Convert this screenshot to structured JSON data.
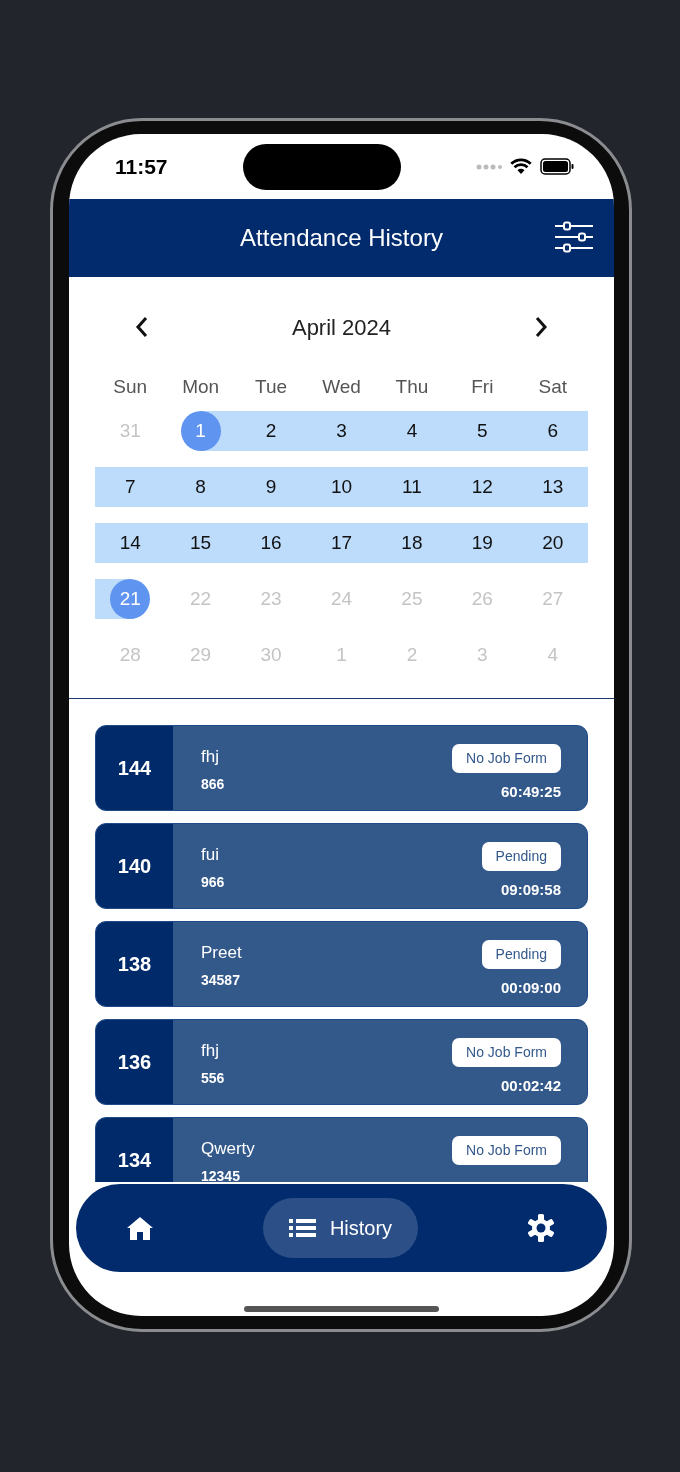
{
  "status_bar": {
    "time": "11:57"
  },
  "header": {
    "title": "Attendance History"
  },
  "calendar": {
    "month": "April 2024",
    "weekdays": [
      "Sun",
      "Mon",
      "Tue",
      "Wed",
      "Thu",
      "Fri",
      "Sat"
    ],
    "weeks": [
      [
        {
          "day": "31",
          "muted": true,
          "selected": false,
          "in_range": false
        },
        {
          "day": "1",
          "muted": false,
          "selected": true,
          "in_range": true
        },
        {
          "day": "2",
          "muted": false,
          "selected": false,
          "in_range": true
        },
        {
          "day": "3",
          "muted": false,
          "selected": false,
          "in_range": true
        },
        {
          "day": "4",
          "muted": false,
          "selected": false,
          "in_range": true
        },
        {
          "day": "5",
          "muted": false,
          "selected": false,
          "in_range": true
        },
        {
          "day": "6",
          "muted": false,
          "selected": false,
          "in_range": true
        }
      ],
      [
        {
          "day": "7",
          "muted": false,
          "selected": false,
          "in_range": true
        },
        {
          "day": "8",
          "muted": false,
          "selected": false,
          "in_range": true
        },
        {
          "day": "9",
          "muted": false,
          "selected": false,
          "in_range": true
        },
        {
          "day": "10",
          "muted": false,
          "selected": false,
          "in_range": true
        },
        {
          "day": "11",
          "muted": false,
          "selected": false,
          "in_range": true
        },
        {
          "day": "12",
          "muted": false,
          "selected": false,
          "in_range": true
        },
        {
          "day": "13",
          "muted": false,
          "selected": false,
          "in_range": true
        }
      ],
      [
        {
          "day": "14",
          "muted": false,
          "selected": false,
          "in_range": true
        },
        {
          "day": "15",
          "muted": false,
          "selected": false,
          "in_range": true
        },
        {
          "day": "16",
          "muted": false,
          "selected": false,
          "in_range": true
        },
        {
          "day": "17",
          "muted": false,
          "selected": false,
          "in_range": true
        },
        {
          "day": "18",
          "muted": false,
          "selected": false,
          "in_range": true
        },
        {
          "day": "19",
          "muted": false,
          "selected": false,
          "in_range": true
        },
        {
          "day": "20",
          "muted": false,
          "selected": false,
          "in_range": true
        }
      ],
      [
        {
          "day": "21",
          "muted": false,
          "selected": true,
          "in_range": true
        },
        {
          "day": "22",
          "muted": true,
          "selected": false,
          "in_range": false
        },
        {
          "day": "23",
          "muted": true,
          "selected": false,
          "in_range": false
        },
        {
          "day": "24",
          "muted": true,
          "selected": false,
          "in_range": false
        },
        {
          "day": "25",
          "muted": true,
          "selected": false,
          "in_range": false
        },
        {
          "day": "26",
          "muted": true,
          "selected": false,
          "in_range": false
        },
        {
          "day": "27",
          "muted": true,
          "selected": false,
          "in_range": false
        }
      ],
      [
        {
          "day": "28",
          "muted": true,
          "selected": false,
          "in_range": false
        },
        {
          "day": "29",
          "muted": true,
          "selected": false,
          "in_range": false
        },
        {
          "day": "30",
          "muted": true,
          "selected": false,
          "in_range": false
        },
        {
          "day": "1",
          "muted": true,
          "selected": false,
          "in_range": false
        },
        {
          "day": "2",
          "muted": true,
          "selected": false,
          "in_range": false
        },
        {
          "day": "3",
          "muted": true,
          "selected": false,
          "in_range": false
        },
        {
          "day": "4",
          "muted": true,
          "selected": false,
          "in_range": false
        }
      ]
    ]
  },
  "records": [
    {
      "number": "144",
      "name": "fhj",
      "code": "866",
      "status": "No Job Form",
      "time": "60:49:25"
    },
    {
      "number": "140",
      "name": "fui",
      "code": "966",
      "status": "Pending",
      "time": "09:09:58"
    },
    {
      "number": "138",
      "name": "Preet",
      "code": "34587",
      "status": "Pending",
      "time": "00:09:00"
    },
    {
      "number": "136",
      "name": "fhj",
      "code": "556",
      "status": "No Job Form",
      "time": "00:02:42"
    },
    {
      "number": "134",
      "name": "Qwerty",
      "code": "12345",
      "status": "No Job Form"
    }
  ],
  "bottom_nav": [
    {
      "kind": "home",
      "selected": false
    },
    {
      "kind": "history",
      "selected": true,
      "label": "History"
    },
    {
      "kind": "settings",
      "selected": false
    }
  ]
}
